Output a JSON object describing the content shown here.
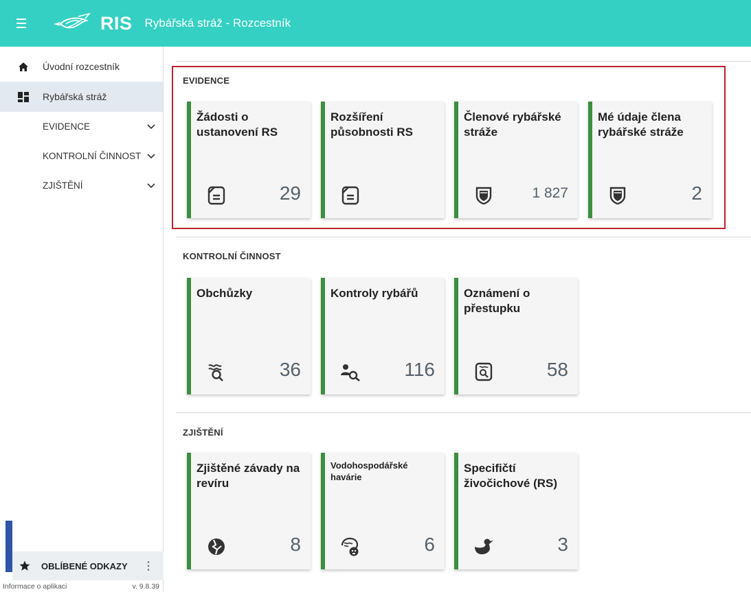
{
  "header": {
    "logo_text": "RIS",
    "title": "Rybářská stráž - Rozcestník",
    "menu_icon": "hamburger-icon"
  },
  "sidebar": {
    "items": [
      {
        "label": "Úvodní rozcestník",
        "icon": "home-icon"
      },
      {
        "label": "Rybářská stráž",
        "icon": "dashboard-icon",
        "active": true
      }
    ],
    "groups": [
      {
        "label": "EVIDENCE"
      },
      {
        "label": "KONTROLNÍ ČINNOST"
      },
      {
        "label": "ZJIŠTĚNÍ"
      }
    ],
    "favorites_label": "OBLÍBENÉ ODKAZY",
    "favorites_more": "⋮",
    "app_info": "Informace o aplikaci",
    "version": "v. 9.8.39"
  },
  "sections": {
    "evidence": {
      "title": "EVIDENCE",
      "tiles": [
        {
          "title": "Žádosti o ustanovení RS",
          "count": "29",
          "icon": "document-icon"
        },
        {
          "title": "Rozšíření působnosti RS",
          "count": "",
          "icon": "document-icon"
        },
        {
          "title": "Členové rybářské stráže",
          "count": "1 827",
          "icon": "badge-shield-icon"
        },
        {
          "title": "Mé údaje člena rybářské stráže",
          "count": "2",
          "icon": "badge-shield-icon"
        }
      ]
    },
    "kontrolni": {
      "title": "KONTROLNÍ ČINNOST",
      "tiles": [
        {
          "title": "Obchůzky",
          "count": "36",
          "icon": "water-search-icon"
        },
        {
          "title": "Kontroly rybářů",
          "count": "116",
          "icon": "person-search-icon"
        },
        {
          "title": "Oznámení o přestupku",
          "count": "58",
          "icon": "report-search-icon"
        }
      ]
    },
    "zjisteni": {
      "title": "ZJIŠTĚNÍ",
      "tiles": [
        {
          "title": "Zjištěné závady na revíru",
          "count": "8",
          "icon": "broken-globe-icon"
        },
        {
          "title": "Vodohospodářské havárie",
          "count": "6",
          "icon": "toxic-water-icon"
        },
        {
          "title": "Specifičtí živočichové (RS)",
          "count": "3",
          "icon": "duck-icon"
        }
      ]
    }
  },
  "colors": {
    "header": "#34d0c3",
    "tile_accent": "#3b8f3e",
    "highlight": "#b8232f",
    "favorites_accent": "#2f56a6"
  }
}
